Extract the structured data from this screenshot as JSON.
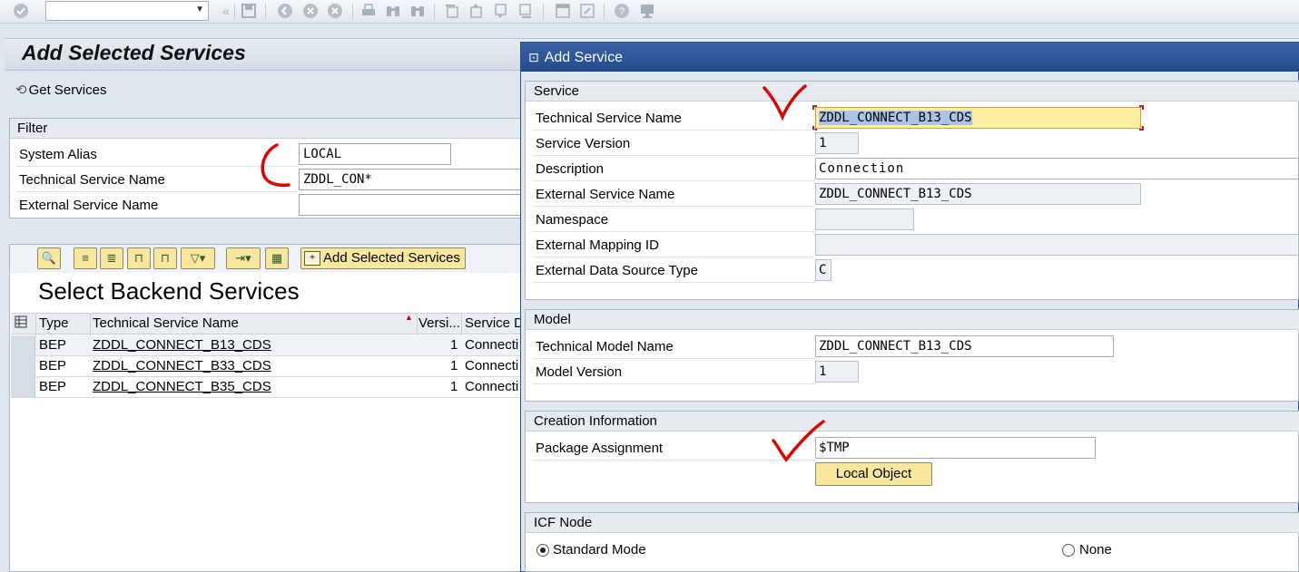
{
  "toolbar": {
    "command_field": {
      "value": "",
      "placeholder": ""
    },
    "icons": [
      "enter-icon",
      "back-icon",
      "save-icon",
      "back-nav-icon",
      "exit-icon",
      "cancel-icon",
      "print-icon",
      "find-icon",
      "find-next-icon",
      "first-page-icon",
      "prev-page-icon",
      "next-page-icon",
      "last-page-icon",
      "new-session-icon",
      "shortcut-icon",
      "help-icon",
      "layout-icon"
    ]
  },
  "main": {
    "title": "Add Selected Services",
    "get_services_label": "Get Services",
    "filter": {
      "title": "Filter",
      "fields": [
        {
          "label": "System Alias",
          "value": "LOCAL"
        },
        {
          "label": "Technical Service Name",
          "value": "ZDDL_CON*"
        },
        {
          "label": "External Service Name",
          "value": ""
        }
      ]
    },
    "backend": {
      "add_selected_label": "Add Selected Services",
      "title": "Select Backend Services",
      "columns": [
        "Type",
        "Technical Service Name",
        "Versi...",
        "Service D"
      ],
      "rows": [
        {
          "type": "BEP",
          "name": "ZDDL_CONNECT_B13_CDS",
          "version": "1",
          "desc": "Connecti"
        },
        {
          "type": "BEP",
          "name": "ZDDL_CONNECT_B33_CDS",
          "version": "1",
          "desc": "Connecti"
        },
        {
          "type": "BEP",
          "name": "ZDDL_CONNECT_B35_CDS",
          "version": "1",
          "desc": "Connecti"
        }
      ]
    }
  },
  "dialog": {
    "title": "Add Service",
    "service": {
      "title": "Service",
      "technical_service_name": {
        "label": "Technical Service Name",
        "value": "ZDDL_CONNECT_B13_CDS"
      },
      "service_version": {
        "label": "Service Version",
        "value": "1"
      },
      "description": {
        "label": "Description",
        "value": "Connection"
      },
      "external_service_name": {
        "label": "External Service Name",
        "value": "ZDDL_CONNECT_B13_CDS"
      },
      "namespace": {
        "label": "Namespace",
        "value": ""
      },
      "external_mapping_id": {
        "label": "External Mapping ID",
        "value": ""
      },
      "external_data_source_type": {
        "label": "External Data Source Type",
        "value": "C"
      }
    },
    "model": {
      "title": "Model",
      "technical_model_name": {
        "label": "Technical Model Name",
        "value": "ZDDL_CONNECT_B13_CDS"
      },
      "model_version": {
        "label": "Model Version",
        "value": "1"
      }
    },
    "creation": {
      "title": "Creation Information",
      "package_assignment": {
        "label": "Package Assignment",
        "value": "$TMP"
      },
      "local_object_label": "Local Object"
    },
    "icf": {
      "title": "ICF Node",
      "standard_mode_label": "Standard Mode",
      "none_label": "None",
      "selected": "Standard Mode"
    }
  },
  "colors": {
    "dialog_title": "#2b4f88",
    "button_yellow": "#f9e79f",
    "focus_field": "#ffef9f",
    "annotation_red": "#e00000"
  }
}
